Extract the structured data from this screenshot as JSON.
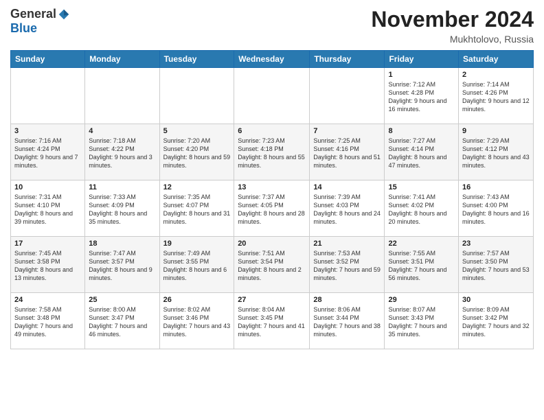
{
  "logo": {
    "general": "General",
    "blue": "Blue"
  },
  "title": "November 2024",
  "location": "Mukhtolovo, Russia",
  "headers": [
    "Sunday",
    "Monday",
    "Tuesday",
    "Wednesday",
    "Thursday",
    "Friday",
    "Saturday"
  ],
  "weeks": [
    [
      {
        "day": "",
        "info": ""
      },
      {
        "day": "",
        "info": ""
      },
      {
        "day": "",
        "info": ""
      },
      {
        "day": "",
        "info": ""
      },
      {
        "day": "",
        "info": ""
      },
      {
        "day": "1",
        "info": "Sunrise: 7:12 AM\nSunset: 4:28 PM\nDaylight: 9 hours and 16 minutes."
      },
      {
        "day": "2",
        "info": "Sunrise: 7:14 AM\nSunset: 4:26 PM\nDaylight: 9 hours and 12 minutes."
      }
    ],
    [
      {
        "day": "3",
        "info": "Sunrise: 7:16 AM\nSunset: 4:24 PM\nDaylight: 9 hours and 7 minutes."
      },
      {
        "day": "4",
        "info": "Sunrise: 7:18 AM\nSunset: 4:22 PM\nDaylight: 9 hours and 3 minutes."
      },
      {
        "day": "5",
        "info": "Sunrise: 7:20 AM\nSunset: 4:20 PM\nDaylight: 8 hours and 59 minutes."
      },
      {
        "day": "6",
        "info": "Sunrise: 7:23 AM\nSunset: 4:18 PM\nDaylight: 8 hours and 55 minutes."
      },
      {
        "day": "7",
        "info": "Sunrise: 7:25 AM\nSunset: 4:16 PM\nDaylight: 8 hours and 51 minutes."
      },
      {
        "day": "8",
        "info": "Sunrise: 7:27 AM\nSunset: 4:14 PM\nDaylight: 8 hours and 47 minutes."
      },
      {
        "day": "9",
        "info": "Sunrise: 7:29 AM\nSunset: 4:12 PM\nDaylight: 8 hours and 43 minutes."
      }
    ],
    [
      {
        "day": "10",
        "info": "Sunrise: 7:31 AM\nSunset: 4:10 PM\nDaylight: 8 hours and 39 minutes."
      },
      {
        "day": "11",
        "info": "Sunrise: 7:33 AM\nSunset: 4:09 PM\nDaylight: 8 hours and 35 minutes."
      },
      {
        "day": "12",
        "info": "Sunrise: 7:35 AM\nSunset: 4:07 PM\nDaylight: 8 hours and 31 minutes."
      },
      {
        "day": "13",
        "info": "Sunrise: 7:37 AM\nSunset: 4:05 PM\nDaylight: 8 hours and 28 minutes."
      },
      {
        "day": "14",
        "info": "Sunrise: 7:39 AM\nSunset: 4:03 PM\nDaylight: 8 hours and 24 minutes."
      },
      {
        "day": "15",
        "info": "Sunrise: 7:41 AM\nSunset: 4:02 PM\nDaylight: 8 hours and 20 minutes."
      },
      {
        "day": "16",
        "info": "Sunrise: 7:43 AM\nSunset: 4:00 PM\nDaylight: 8 hours and 16 minutes."
      }
    ],
    [
      {
        "day": "17",
        "info": "Sunrise: 7:45 AM\nSunset: 3:58 PM\nDaylight: 8 hours and 13 minutes."
      },
      {
        "day": "18",
        "info": "Sunrise: 7:47 AM\nSunset: 3:57 PM\nDaylight: 8 hours and 9 minutes."
      },
      {
        "day": "19",
        "info": "Sunrise: 7:49 AM\nSunset: 3:55 PM\nDaylight: 8 hours and 6 minutes."
      },
      {
        "day": "20",
        "info": "Sunrise: 7:51 AM\nSunset: 3:54 PM\nDaylight: 8 hours and 2 minutes."
      },
      {
        "day": "21",
        "info": "Sunrise: 7:53 AM\nSunset: 3:52 PM\nDaylight: 7 hours and 59 minutes."
      },
      {
        "day": "22",
        "info": "Sunrise: 7:55 AM\nSunset: 3:51 PM\nDaylight: 7 hours and 56 minutes."
      },
      {
        "day": "23",
        "info": "Sunrise: 7:57 AM\nSunset: 3:50 PM\nDaylight: 7 hours and 53 minutes."
      }
    ],
    [
      {
        "day": "24",
        "info": "Sunrise: 7:58 AM\nSunset: 3:48 PM\nDaylight: 7 hours and 49 minutes."
      },
      {
        "day": "25",
        "info": "Sunrise: 8:00 AM\nSunset: 3:47 PM\nDaylight: 7 hours and 46 minutes."
      },
      {
        "day": "26",
        "info": "Sunrise: 8:02 AM\nSunset: 3:46 PM\nDaylight: 7 hours and 43 minutes."
      },
      {
        "day": "27",
        "info": "Sunrise: 8:04 AM\nSunset: 3:45 PM\nDaylight: 7 hours and 41 minutes."
      },
      {
        "day": "28",
        "info": "Sunrise: 8:06 AM\nSunset: 3:44 PM\nDaylight: 7 hours and 38 minutes."
      },
      {
        "day": "29",
        "info": "Sunrise: 8:07 AM\nSunset: 3:43 PM\nDaylight: 7 hours and 35 minutes."
      },
      {
        "day": "30",
        "info": "Sunrise: 8:09 AM\nSunset: 3:42 PM\nDaylight: 7 hours and 32 minutes."
      }
    ]
  ]
}
